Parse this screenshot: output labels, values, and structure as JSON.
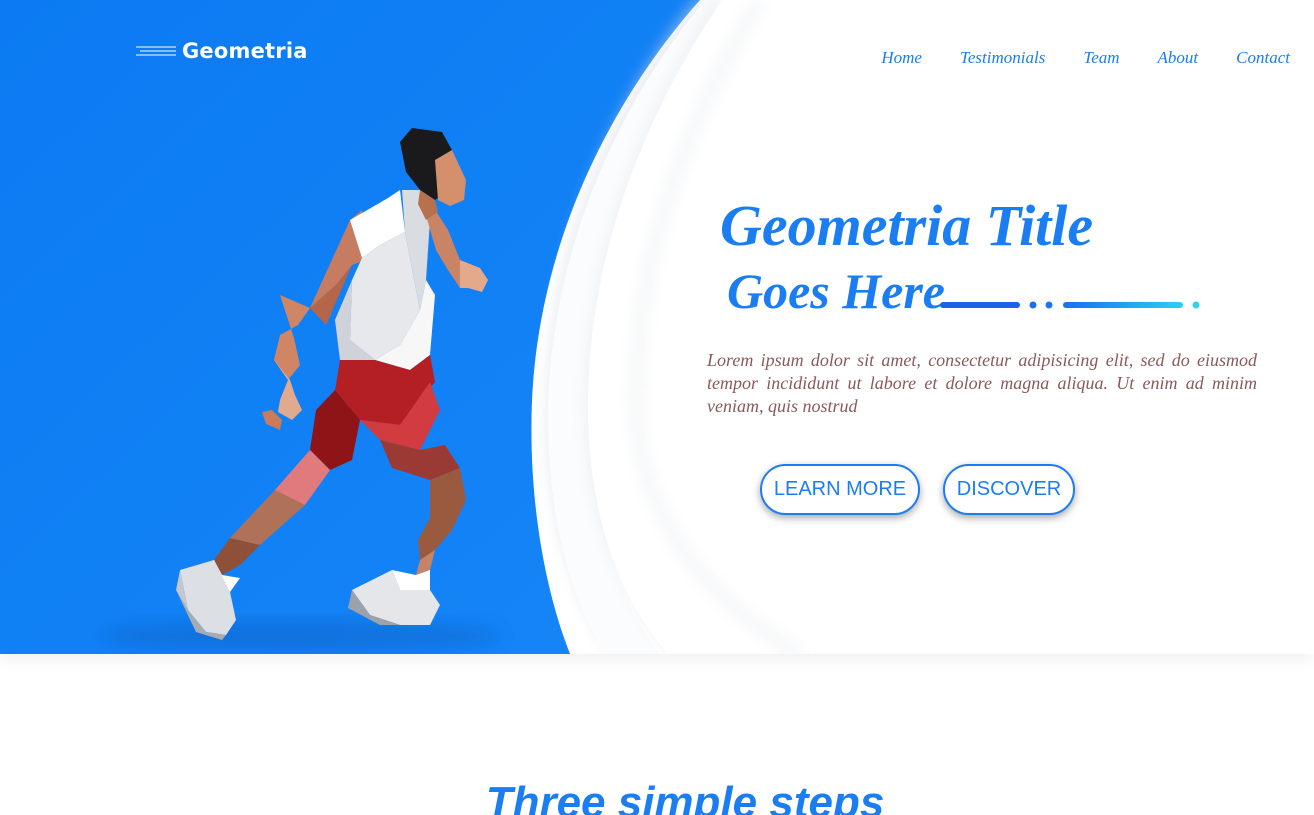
{
  "brand": {
    "name": "Geometria",
    "accent_color": "#1a7ef2",
    "hero_blue": "#0f80f5"
  },
  "nav": {
    "items": [
      {
        "label": "Home"
      },
      {
        "label": "Testimonials"
      },
      {
        "label": "Team"
      },
      {
        "label": "About"
      },
      {
        "label": "Contact"
      }
    ]
  },
  "hero": {
    "title_line1": "Geometria Title",
    "title_line2": "Goes Here",
    "lead": "Lorem ipsum dolor sit amet, consectetur adipisicing elit, sed do eiusmod tempor incididunt ut labore et dolore magna aliqua. Ut enim ad minim veniam, quis nostrud",
    "buttons": {
      "learn_more": "LEARN MORE",
      "discover": "DISCOVER"
    },
    "illustration": "low-poly-runner-icon"
  },
  "steps": {
    "title": "Three simple steps"
  }
}
